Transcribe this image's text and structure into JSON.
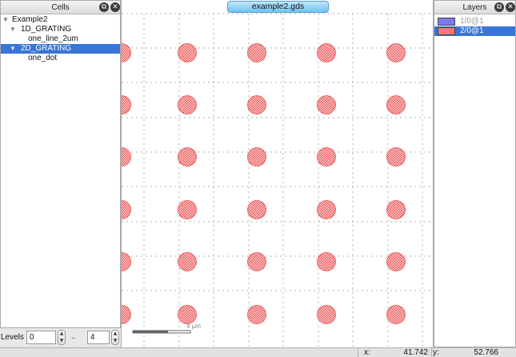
{
  "cells_panel": {
    "title": "Cells",
    "tree": [
      {
        "label": "Example2",
        "indent": 0,
        "expanded": true,
        "selected": false
      },
      {
        "label": "1D_GRATING",
        "indent": 1,
        "expanded": true,
        "selected": false
      },
      {
        "label": "one_line_2um",
        "indent": 2,
        "expanded": false,
        "selected": false
      },
      {
        "label": "2D_GRATING",
        "indent": 1,
        "expanded": true,
        "selected": true
      },
      {
        "label": "one_dot",
        "indent": 2,
        "expanded": false,
        "selected": false
      }
    ],
    "levels": {
      "label": "Levels",
      "from": "0",
      "separator": "..",
      "to": "4"
    }
  },
  "canvas": {
    "tab_title": "example2.gds",
    "scale_label": "4  µm",
    "dot_color": "#e84a4a",
    "grid_color": "#b0b0b0"
  },
  "layers_panel": {
    "title": "Layers",
    "layers": [
      {
        "name": "1/0@1",
        "color": "#7b7bf0",
        "selected": false,
        "hidden": true
      },
      {
        "name": "2/0@1",
        "color": "#f07a7a",
        "selected": true,
        "hidden": false
      }
    ]
  },
  "status_bar": {
    "x_label": "x:",
    "x_value": "41.742",
    "y_label": "y:",
    "y_value": "52.766"
  }
}
